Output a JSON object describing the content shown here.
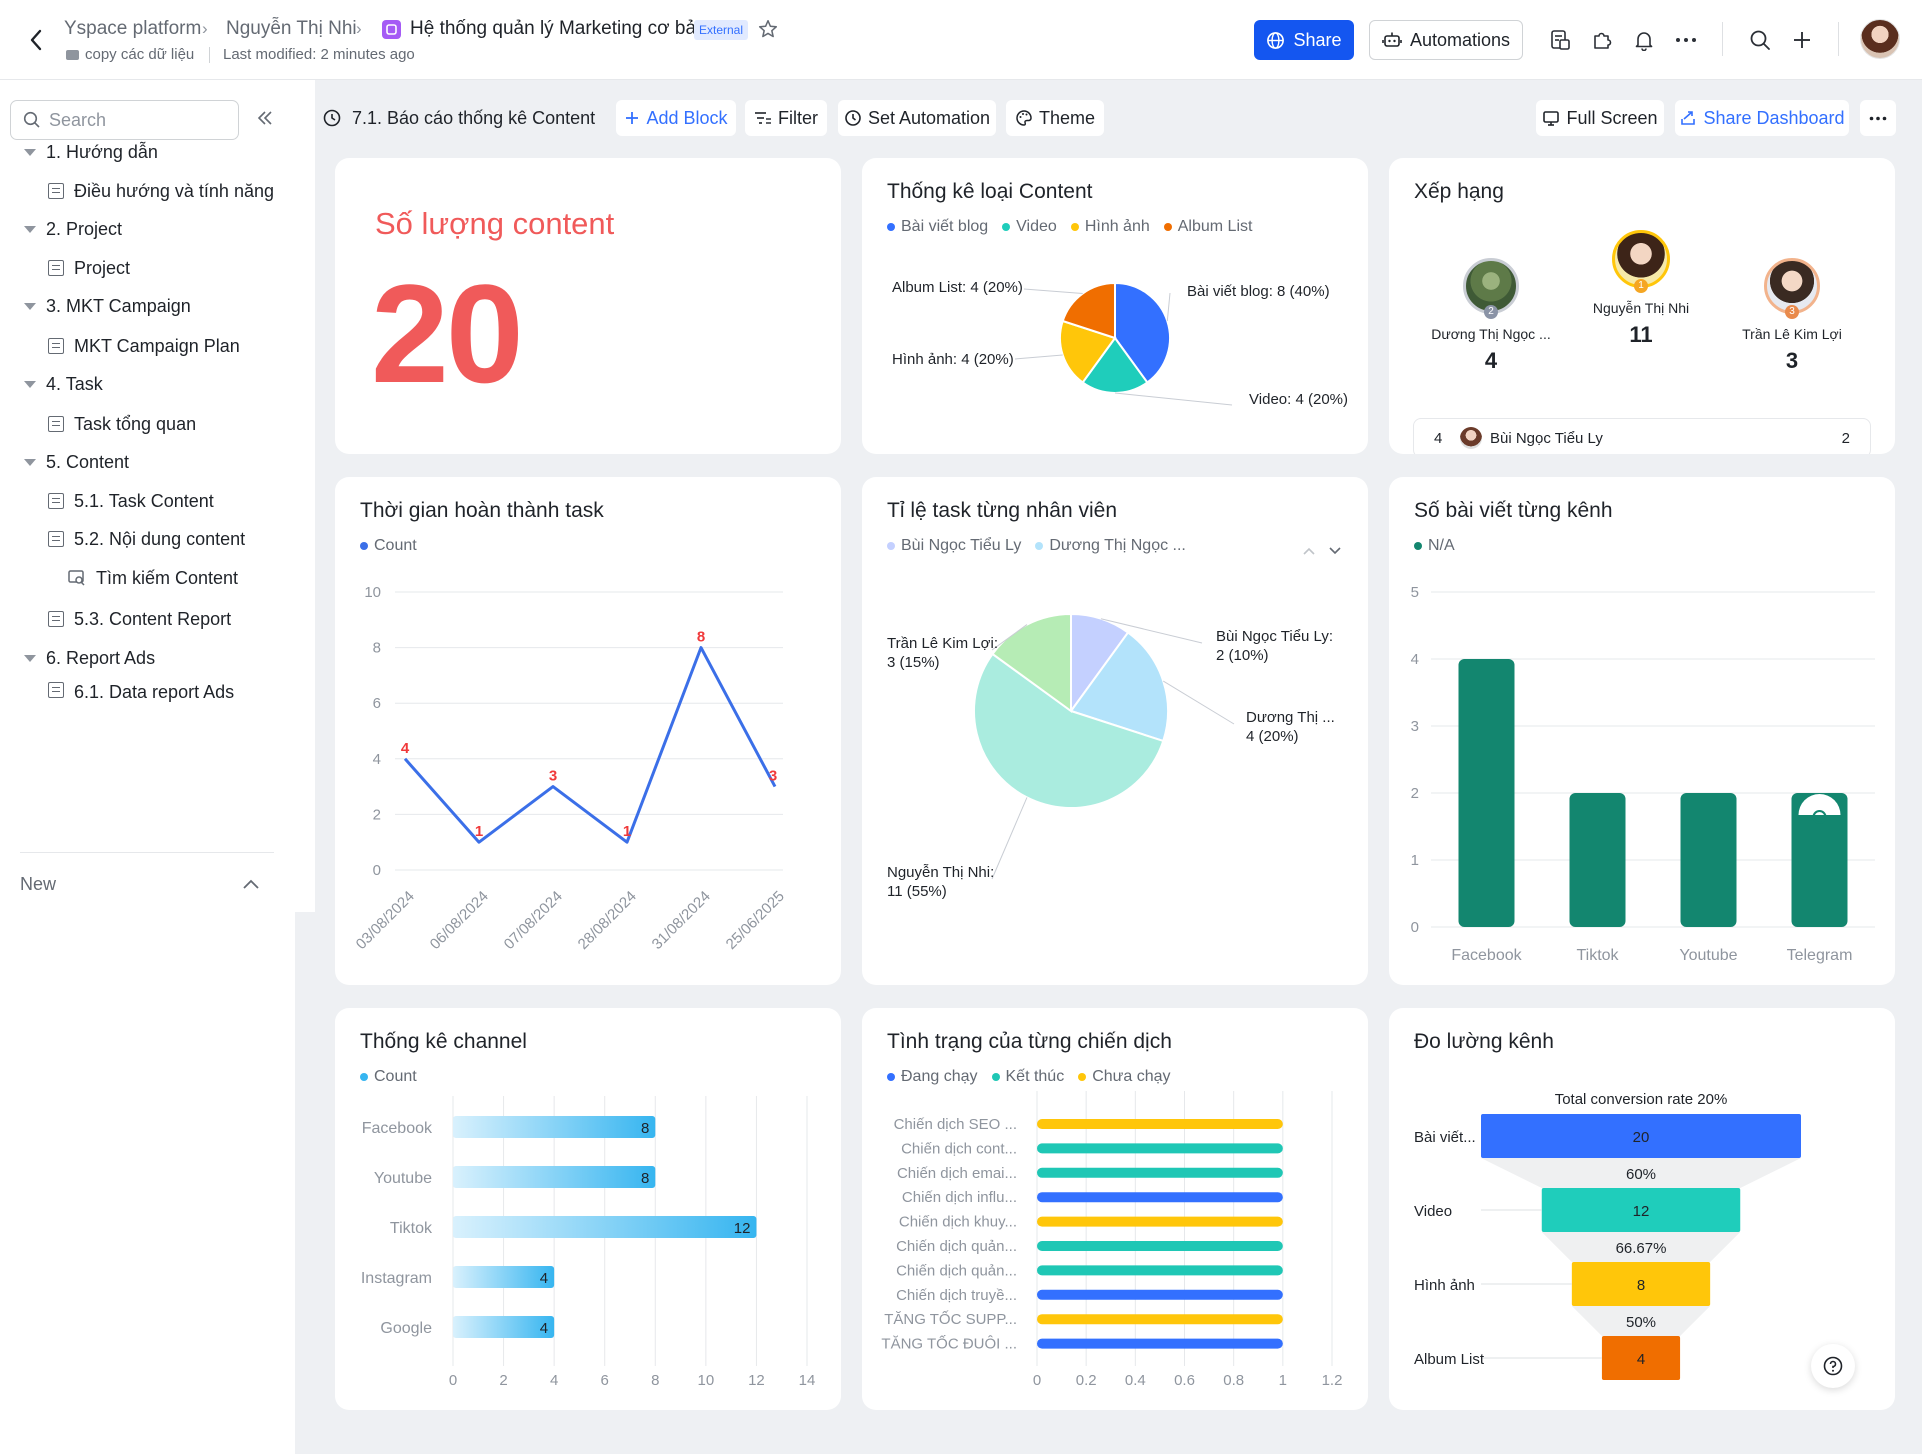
{
  "header": {
    "breadcrumb": [
      "Yspace platform",
      "Nguyễn Thị Nhi",
      "Hệ thống quản lý Marketing cơ bản"
    ],
    "external_badge": "External",
    "folder": "copy các dữ liệu",
    "last_modified": "Last modified: 2 minutes ago",
    "share_label": "Share",
    "automations_label": "Automations"
  },
  "sidebar": {
    "search_placeholder": "Search",
    "items": [
      {
        "label": "1. Hướng dẫn",
        "type": "group"
      },
      {
        "label": "Điều hướng và tính năng",
        "type": "doc"
      },
      {
        "label": "2. Project",
        "type": "group"
      },
      {
        "label": "Project",
        "type": "doc"
      },
      {
        "label": "3. MKT Campaign",
        "type": "group"
      },
      {
        "label": "MKT Campaign Plan",
        "type": "doc"
      },
      {
        "label": "4. Task",
        "type": "group"
      },
      {
        "label": "Task tổng quan",
        "type": "doc"
      },
      {
        "label": "5. Content",
        "type": "group"
      },
      {
        "label": "5.1. Task Content",
        "type": "doc"
      },
      {
        "label": "5.2. Nội dung content",
        "type": "doc"
      },
      {
        "label": "Tìm kiếm Content",
        "type": "search"
      },
      {
        "label": "5.3. Content Report",
        "type": "doc"
      },
      {
        "label": "6. Report Ads",
        "type": "group"
      },
      {
        "label": "6.1. Data report Ads",
        "type": "doc"
      }
    ],
    "new_label": "New"
  },
  "toolbar": {
    "dashboard_name": "7.1. Báo cáo thống kê Content",
    "add_block": "Add Block",
    "filter": "Filter",
    "set_automation": "Set Automation",
    "theme": "Theme",
    "full_screen": "Full Screen",
    "share_dashboard": "Share Dashboard"
  },
  "cards": {
    "count": {
      "title": "Số lượng content",
      "value": "20",
      "color": "#f05a5a"
    },
    "content_type": {
      "title": "Thống kê loại Content"
    },
    "ranking": {
      "title": "Xếp hạng",
      "podium": [
        {
          "rank": "2",
          "name": "Dương Thị Ngọc ...",
          "score": "4"
        },
        {
          "rank": "1",
          "name": "Nguyễn Thị Nhi",
          "score": "11"
        },
        {
          "rank": "3",
          "name": "Trần Lê Kim Lợi",
          "score": "3"
        }
      ],
      "row": {
        "rank": "4",
        "name": "Bùi Ngọc Tiểu Ly",
        "score": "2"
      }
    },
    "task_time": {
      "title": "Thời gian hoàn thành task"
    },
    "task_ratio": {
      "title": "Tỉ lệ task từng nhân viên"
    },
    "posts_channel": {
      "title": "Số bài viết từng kênh"
    },
    "channel_stats": {
      "title": "Thống kê channel"
    },
    "campaign_status": {
      "title": "Tình trạng của từng chiến dịch"
    },
    "channel_measure": {
      "title": "Đo lường kênh"
    }
  },
  "chart_data": [
    {
      "type": "pie",
      "title": "Thống kê loại Content",
      "labels": [
        "Bài viết blog",
        "Video",
        "Hình ảnh",
        "Album List"
      ],
      "values": [
        8,
        4,
        4,
        4
      ],
      "data_labels": [
        "Bài viết blog: 8 (40%)",
        "Video: 4 (20%)",
        "Hình ảnh: 4 (20%)",
        "Album List: 4 (20%)"
      ],
      "colors": [
        "#3370ff",
        "#1fcdbb",
        "#ffc60a",
        "#f06e00"
      ]
    },
    {
      "type": "line",
      "title": "Thời gian hoàn thành task",
      "series": [
        {
          "name": "Count",
          "values": [
            4,
            1,
            3,
            1,
            8,
            3
          ]
        }
      ],
      "categories": [
        "03/08/2024",
        "06/08/2024",
        "07/08/2024",
        "28/08/2024",
        "31/08/2024",
        "25/06/2025"
      ],
      "ylim": [
        0,
        10
      ],
      "yticks": [
        0,
        2,
        4,
        6,
        8,
        10
      ],
      "color": "#3b6fe8",
      "label_color": "#f0393a"
    },
    {
      "type": "pie",
      "title": "Tỉ lệ task từng nhân viên",
      "labels": [
        "Bùi Ngọc Tiểu Ly",
        "Dương Thị Ngọc ...",
        "Nguyễn Thị Nhi",
        "Trần Lê Kim Lợi"
      ],
      "values": [
        2,
        4,
        11,
        3
      ],
      "data_labels": [
        "Bùi Ngọc Tiểu Ly:\n2 (10%)",
        "Dương Thị ...\n4 (20%)",
        "Nguyễn Thị  Nhi:\n11 (55%)",
        "Trần Lê Kim Lợi:\n3 (15%)"
      ],
      "colors": [
        "#c4d0ff",
        "#b3e3fb",
        "#aaecdf",
        "#b6ecb5"
      ]
    },
    {
      "type": "bar",
      "title": "Số bài viết từng kênh",
      "series": [
        {
          "name": "N/A",
          "values": [
            4,
            2,
            2,
            2
          ]
        }
      ],
      "categories": [
        "Facebook",
        "Tiktok",
        "Youtube",
        "Telegram"
      ],
      "ylim": [
        0,
        5
      ],
      "yticks": [
        0,
        1,
        2,
        3,
        4,
        5
      ],
      "color": "#13866f"
    },
    {
      "type": "bar",
      "orientation": "horizontal",
      "title": "Thống kê channel",
      "series": [
        {
          "name": "Count",
          "values": [
            8,
            8,
            12,
            4,
            4
          ]
        }
      ],
      "categories": [
        "Facebook",
        "Youtube",
        "Tiktok",
        "Instagram",
        "Google"
      ],
      "xlim": [
        0,
        14
      ],
      "xticks": [
        0,
        2,
        4,
        6,
        8,
        10,
        12,
        14
      ],
      "color": "#36b5f0"
    },
    {
      "type": "bar",
      "orientation": "horizontal",
      "title": "Tình trạng của từng chiến dịch",
      "legend": [
        "Đang chạy",
        "Kết thúc",
        "Chưa chạy"
      ],
      "legend_colors": [
        "#3370ff",
        "#1fc7b5",
        "#ffc60a"
      ],
      "categories": [
        "Chiến dịch SEO ...",
        "Chiến dịch cont...",
        "Chiến dịch emai...",
        "Chiến dịch influ...",
        "Chiến dịch khuy...",
        "Chiến dịch quản...",
        "Chiến dịch quản...",
        "Chiến dịch truyề...",
        "TĂNG TỐC SUPP...",
        "TĂNG TỐC ĐUÔI ..."
      ],
      "status": [
        "Chưa chạy",
        "Kết thúc",
        "Kết thúc",
        "Đang chạy",
        "Chưa chạy",
        "Kết thúc",
        "Kết thúc",
        "Đang chạy",
        "Chưa chạy",
        "Đang chạy"
      ],
      "values": [
        1,
        1,
        1,
        1,
        1,
        1,
        1,
        1,
        1,
        1
      ],
      "xlim": [
        0,
        1.2
      ],
      "xticks": [
        "0",
        "0.2",
        "0.4",
        "0.6",
        "0.8",
        "1",
        "1.2"
      ]
    },
    {
      "type": "funnel",
      "title": "Đo lường kênh",
      "subtitle": "Total conversion rate 20%",
      "categories": [
        "Bài viết...",
        "Video",
        "Hình ảnh",
        "Album List"
      ],
      "values": [
        20,
        12,
        8,
        4
      ],
      "conversion": [
        "60%",
        "66.67%",
        "50%"
      ],
      "colors": [
        "#3370ff",
        "#1fcdbb",
        "#ffc60a",
        "#f06e00"
      ]
    }
  ]
}
